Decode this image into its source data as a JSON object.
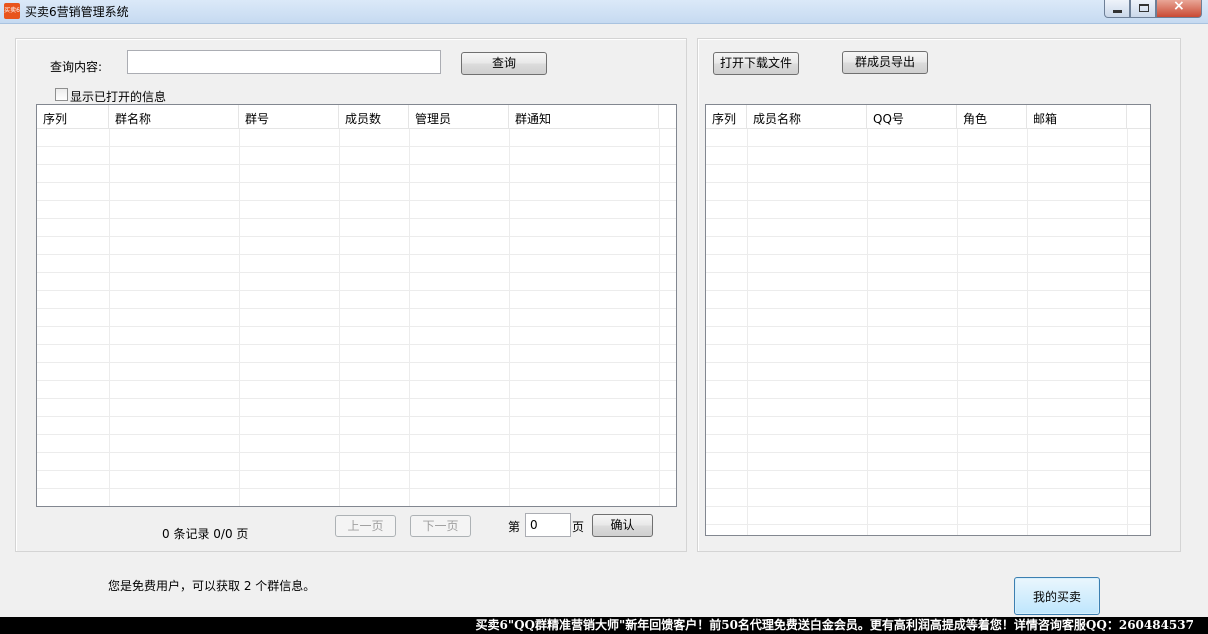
{
  "window": {
    "title": "买卖6营销管理系统",
    "icon_text": "买卖6",
    "icon_color": "#e8541c"
  },
  "left_panel": {
    "search_label": "查询内容:",
    "search_value": "",
    "search_button": "查询",
    "show_opened_label": "显示已打开的信息",
    "show_opened_checked": false,
    "table_columns": [
      "序列",
      "群名称",
      "群号",
      "成员数",
      "管理员",
      "群通知"
    ],
    "table_rows": [],
    "record_summary": "0 条记录 0/0 页",
    "prev_page": "上一页",
    "next_page": "下一页",
    "page_prefix": "第",
    "page_value": "0",
    "page_suffix": "页",
    "confirm": "确认"
  },
  "right_panel": {
    "open_download_button": "打开下载文件",
    "export_members_button": "群成员导出",
    "table_columns": [
      "序列",
      "成员名称",
      "QQ号",
      "角色",
      "邮箱"
    ],
    "table_rows": []
  },
  "footer": {
    "user_status": "您是免费用户，可以获取 2 个群信息。",
    "my_purchase_button": "我的买卖",
    "marquee": "买卖6\"QQ群精准营销大师\"新年回馈客户！前50名代理免费送白金会员。更有高利润高提成等着您！详情咨询客服QQ：260484537"
  }
}
